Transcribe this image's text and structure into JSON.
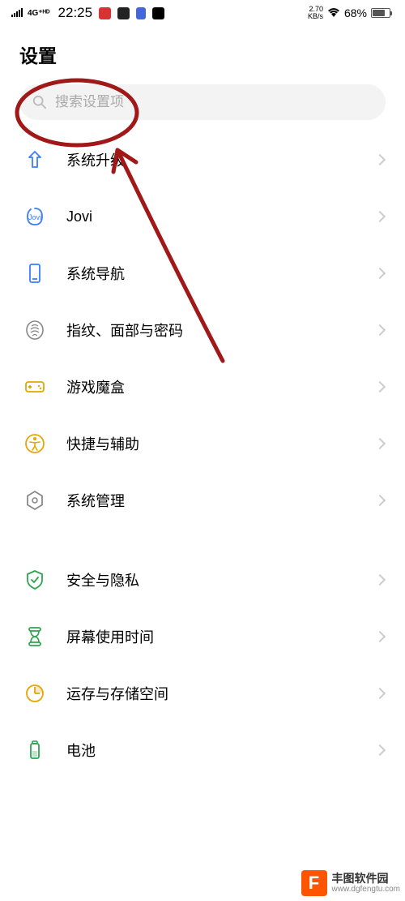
{
  "status_bar": {
    "network": "4G⁺ᴴᴰ",
    "time": "22:25",
    "speed_top": "2.70",
    "speed_bottom": "KB/s",
    "battery_percent": "68%"
  },
  "page_title": "设置",
  "search": {
    "placeholder": "搜索设置项"
  },
  "settings_groups": [
    {
      "items": [
        {
          "id": "system-upgrade",
          "label": "系统升级",
          "icon": "arrow-up",
          "color": "#3a7cff"
        },
        {
          "id": "jovi",
          "label": "Jovi",
          "icon": "jovi",
          "color": "#3a7cff"
        },
        {
          "id": "system-nav",
          "label": "系统导航",
          "icon": "phone-rect",
          "color": "#3a7cff"
        },
        {
          "id": "fingerprint",
          "label": "指纹、面部与密码",
          "icon": "fingerprint",
          "color": "#888888"
        },
        {
          "id": "game-box",
          "label": "游戏魔盒",
          "icon": "gamepad",
          "color": "#e6a600"
        },
        {
          "id": "accessibility",
          "label": "快捷与辅助",
          "icon": "accessibility",
          "color": "#e6a600"
        },
        {
          "id": "system-mgmt",
          "label": "系统管理",
          "icon": "hexagon",
          "color": "#888888"
        }
      ]
    },
    {
      "items": [
        {
          "id": "security",
          "label": "安全与隐私",
          "icon": "shield-check",
          "color": "#2ea44f"
        },
        {
          "id": "screen-time",
          "label": "屏幕使用时间",
          "icon": "hourglass",
          "color": "#2ea44f"
        },
        {
          "id": "storage",
          "label": "运存与存储空间",
          "icon": "pie-clock",
          "color": "#e6a600"
        },
        {
          "id": "battery",
          "label": "电池",
          "icon": "battery",
          "color": "#2ea44f"
        }
      ]
    }
  ],
  "watermark": {
    "logo": "F",
    "name": "丰图软件园",
    "url": "www.dgfengtu.com"
  },
  "annotation": {
    "circle_color": "#a01818",
    "arrow_color": "#a01818"
  }
}
